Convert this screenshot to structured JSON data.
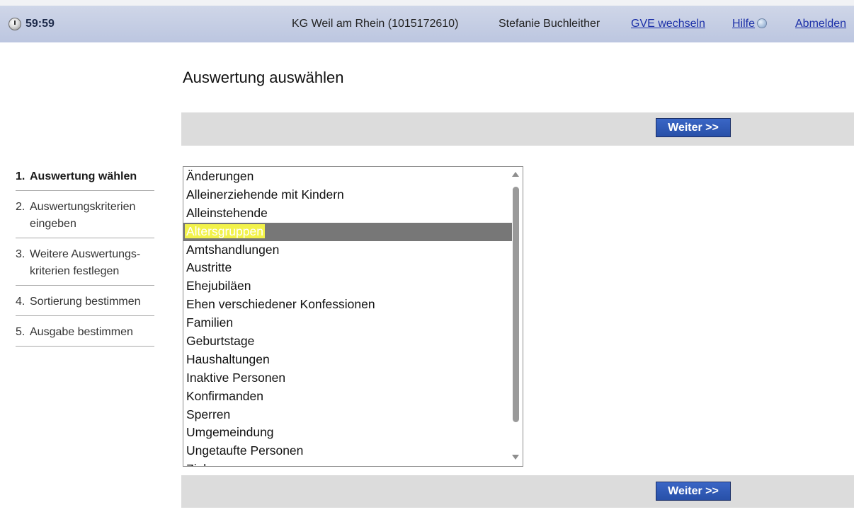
{
  "header": {
    "timer": "59:59",
    "parish": "KG Weil am Rhein (1015172610)",
    "user": "Stefanie Buchleither",
    "switch_link": "GVE wechseln",
    "help_link": "Hilfe",
    "logout_link": "Abmelden"
  },
  "page": {
    "title": "Auswertung auswählen",
    "next_button": "Weiter >>"
  },
  "steps": [
    {
      "number": "1.",
      "label": "Auswertung wählen",
      "active": true
    },
    {
      "number": "2.",
      "label": "Auswertungskriterien eingeben"
    },
    {
      "number": "3.",
      "label": "Weitere Auswertungs-kriterien festlegen"
    },
    {
      "number": "4.",
      "label": "Sortierung bestimmen"
    },
    {
      "number": "5.",
      "label": "Ausgabe bestimmen"
    }
  ],
  "evaluation_list": {
    "selected": "Altersgruppen",
    "options": [
      "Änderungen",
      "Alleinerziehende mit Kindern",
      "Alleinstehende",
      "Altersgruppen",
      "Amtshandlungen",
      "Austritte",
      "Ehejubiläen",
      "Ehen verschiedener Konfessionen",
      "Familien",
      "Geburtstage",
      "Haushaltungen",
      "Inaktive Personen",
      "Konfirmanden",
      "Sperren",
      "Umgemeindung",
      "Ungetaufte Personen",
      "Zielgruppen"
    ]
  },
  "colors": {
    "header_bg": "#c4cde4",
    "button_bg": "#2f59b8",
    "bar_bg": "#dcdcdc",
    "selection_bg": "#777777",
    "highlight": "#f2f24a"
  }
}
